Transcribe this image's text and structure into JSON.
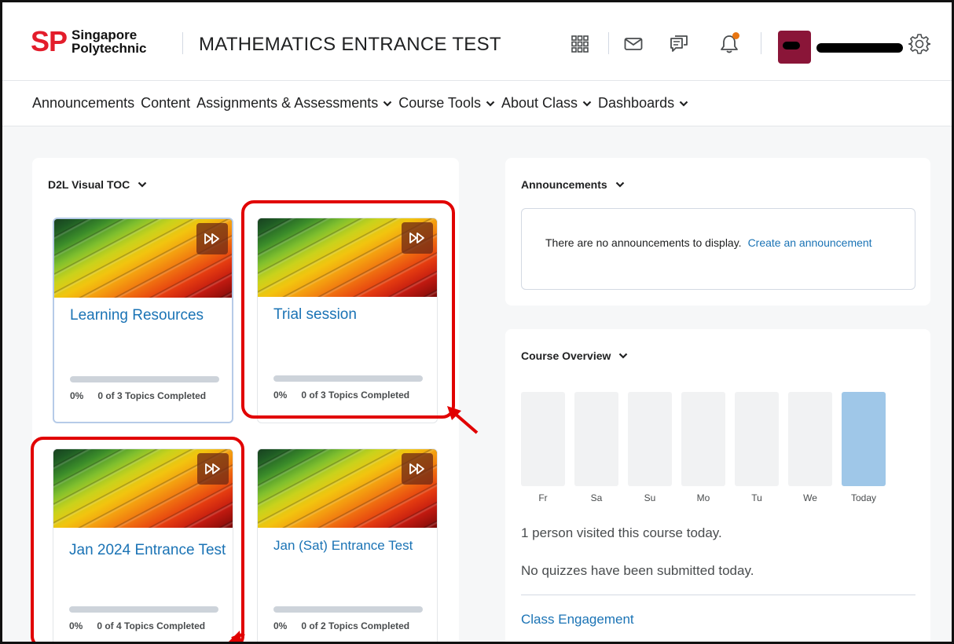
{
  "header": {
    "logo": {
      "mark": "SP",
      "line1": "Singapore",
      "line2": "Polytechnic"
    },
    "course_title": "MATHEMATICS ENTRANCE TEST",
    "icons": [
      "apps-grid-icon",
      "mail-icon",
      "chat-icon",
      "bell-icon",
      "gear-icon"
    ],
    "notification_color": "#e87511",
    "avatar_color": "#8a1538"
  },
  "nav": {
    "items": [
      {
        "label": "Announcements",
        "dropdown": false
      },
      {
        "label": "Content",
        "dropdown": false
      },
      {
        "label": "Assignments & Assessments",
        "dropdown": true
      },
      {
        "label": "Course Tools",
        "dropdown": true
      },
      {
        "label": "About Class",
        "dropdown": true
      },
      {
        "label": "Dashboards",
        "dropdown": true
      }
    ]
  },
  "toc": {
    "title": "D2L Visual TOC",
    "cards": [
      {
        "title": "Learning Resources",
        "percent": "0%",
        "progress": 0,
        "topics": "0 of 3 Topics Completed"
      },
      {
        "title": "Trial session",
        "percent": "0%",
        "progress": 0,
        "topics": "0 of 3 Topics Completed"
      },
      {
        "title": "Jan 2024 Entrance Test",
        "percent": "0%",
        "progress": 0,
        "topics": "0 of 4 Topics Completed"
      },
      {
        "title": "Jan (Sat) Entrance Test",
        "percent": "0%",
        "progress": 0,
        "topics": "0 of 2 Topics Completed"
      }
    ]
  },
  "announcements": {
    "title": "Announcements",
    "empty_text": "There are no announcements to display.",
    "create_link": "Create an announcement"
  },
  "overview": {
    "title": "Course Overview",
    "days": [
      "Fr",
      "Sa",
      "Su",
      "Mo",
      "Tu",
      "We",
      "Today"
    ],
    "visits_text": "1 person visited this course today.",
    "quizzes_text": "No quizzes have been submitted today.",
    "engagement_link": "Class Engagement",
    "bar_color": "#f1f2f3",
    "today_color": "#9fc7e8"
  },
  "annotation_color": "#e10000"
}
